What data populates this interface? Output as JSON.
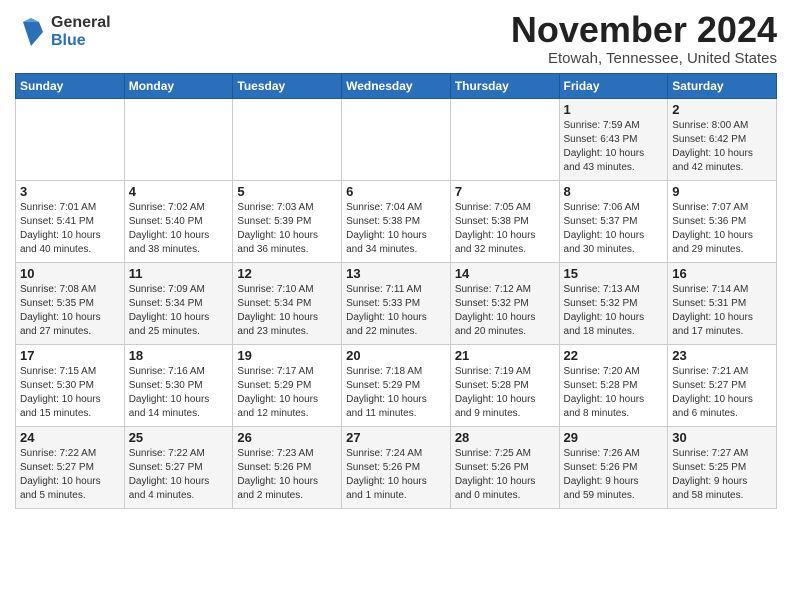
{
  "header": {
    "logo_general": "General",
    "logo_blue": "Blue",
    "title": "November 2024",
    "location": "Etowah, Tennessee, United States"
  },
  "weekdays": [
    "Sunday",
    "Monday",
    "Tuesday",
    "Wednesday",
    "Thursday",
    "Friday",
    "Saturday"
  ],
  "weeks": [
    [
      {
        "day": "",
        "info": ""
      },
      {
        "day": "",
        "info": ""
      },
      {
        "day": "",
        "info": ""
      },
      {
        "day": "",
        "info": ""
      },
      {
        "day": "",
        "info": ""
      },
      {
        "day": "1",
        "info": "Sunrise: 7:59 AM\nSunset: 6:43 PM\nDaylight: 10 hours\nand 43 minutes."
      },
      {
        "day": "2",
        "info": "Sunrise: 8:00 AM\nSunset: 6:42 PM\nDaylight: 10 hours\nand 42 minutes."
      }
    ],
    [
      {
        "day": "3",
        "info": "Sunrise: 7:01 AM\nSunset: 5:41 PM\nDaylight: 10 hours\nand 40 minutes."
      },
      {
        "day": "4",
        "info": "Sunrise: 7:02 AM\nSunset: 5:40 PM\nDaylight: 10 hours\nand 38 minutes."
      },
      {
        "day": "5",
        "info": "Sunrise: 7:03 AM\nSunset: 5:39 PM\nDaylight: 10 hours\nand 36 minutes."
      },
      {
        "day": "6",
        "info": "Sunrise: 7:04 AM\nSunset: 5:38 PM\nDaylight: 10 hours\nand 34 minutes."
      },
      {
        "day": "7",
        "info": "Sunrise: 7:05 AM\nSunset: 5:38 PM\nDaylight: 10 hours\nand 32 minutes."
      },
      {
        "day": "8",
        "info": "Sunrise: 7:06 AM\nSunset: 5:37 PM\nDaylight: 10 hours\nand 30 minutes."
      },
      {
        "day": "9",
        "info": "Sunrise: 7:07 AM\nSunset: 5:36 PM\nDaylight: 10 hours\nand 29 minutes."
      }
    ],
    [
      {
        "day": "10",
        "info": "Sunrise: 7:08 AM\nSunset: 5:35 PM\nDaylight: 10 hours\nand 27 minutes."
      },
      {
        "day": "11",
        "info": "Sunrise: 7:09 AM\nSunset: 5:34 PM\nDaylight: 10 hours\nand 25 minutes."
      },
      {
        "day": "12",
        "info": "Sunrise: 7:10 AM\nSunset: 5:34 PM\nDaylight: 10 hours\nand 23 minutes."
      },
      {
        "day": "13",
        "info": "Sunrise: 7:11 AM\nSunset: 5:33 PM\nDaylight: 10 hours\nand 22 minutes."
      },
      {
        "day": "14",
        "info": "Sunrise: 7:12 AM\nSunset: 5:32 PM\nDaylight: 10 hours\nand 20 minutes."
      },
      {
        "day": "15",
        "info": "Sunrise: 7:13 AM\nSunset: 5:32 PM\nDaylight: 10 hours\nand 18 minutes."
      },
      {
        "day": "16",
        "info": "Sunrise: 7:14 AM\nSunset: 5:31 PM\nDaylight: 10 hours\nand 17 minutes."
      }
    ],
    [
      {
        "day": "17",
        "info": "Sunrise: 7:15 AM\nSunset: 5:30 PM\nDaylight: 10 hours\nand 15 minutes."
      },
      {
        "day": "18",
        "info": "Sunrise: 7:16 AM\nSunset: 5:30 PM\nDaylight: 10 hours\nand 14 minutes."
      },
      {
        "day": "19",
        "info": "Sunrise: 7:17 AM\nSunset: 5:29 PM\nDaylight: 10 hours\nand 12 minutes."
      },
      {
        "day": "20",
        "info": "Sunrise: 7:18 AM\nSunset: 5:29 PM\nDaylight: 10 hours\nand 11 minutes."
      },
      {
        "day": "21",
        "info": "Sunrise: 7:19 AM\nSunset: 5:28 PM\nDaylight: 10 hours\nand 9 minutes."
      },
      {
        "day": "22",
        "info": "Sunrise: 7:20 AM\nSunset: 5:28 PM\nDaylight: 10 hours\nand 8 minutes."
      },
      {
        "day": "23",
        "info": "Sunrise: 7:21 AM\nSunset: 5:27 PM\nDaylight: 10 hours\nand 6 minutes."
      }
    ],
    [
      {
        "day": "24",
        "info": "Sunrise: 7:22 AM\nSunset: 5:27 PM\nDaylight: 10 hours\nand 5 minutes."
      },
      {
        "day": "25",
        "info": "Sunrise: 7:22 AM\nSunset: 5:27 PM\nDaylight: 10 hours\nand 4 minutes."
      },
      {
        "day": "26",
        "info": "Sunrise: 7:23 AM\nSunset: 5:26 PM\nDaylight: 10 hours\nand 2 minutes."
      },
      {
        "day": "27",
        "info": "Sunrise: 7:24 AM\nSunset: 5:26 PM\nDaylight: 10 hours\nand 1 minute."
      },
      {
        "day": "28",
        "info": "Sunrise: 7:25 AM\nSunset: 5:26 PM\nDaylight: 10 hours\nand 0 minutes."
      },
      {
        "day": "29",
        "info": "Sunrise: 7:26 AM\nSunset: 5:26 PM\nDaylight: 9 hours\nand 59 minutes."
      },
      {
        "day": "30",
        "info": "Sunrise: 7:27 AM\nSunset: 5:25 PM\nDaylight: 9 hours\nand 58 minutes."
      }
    ]
  ]
}
